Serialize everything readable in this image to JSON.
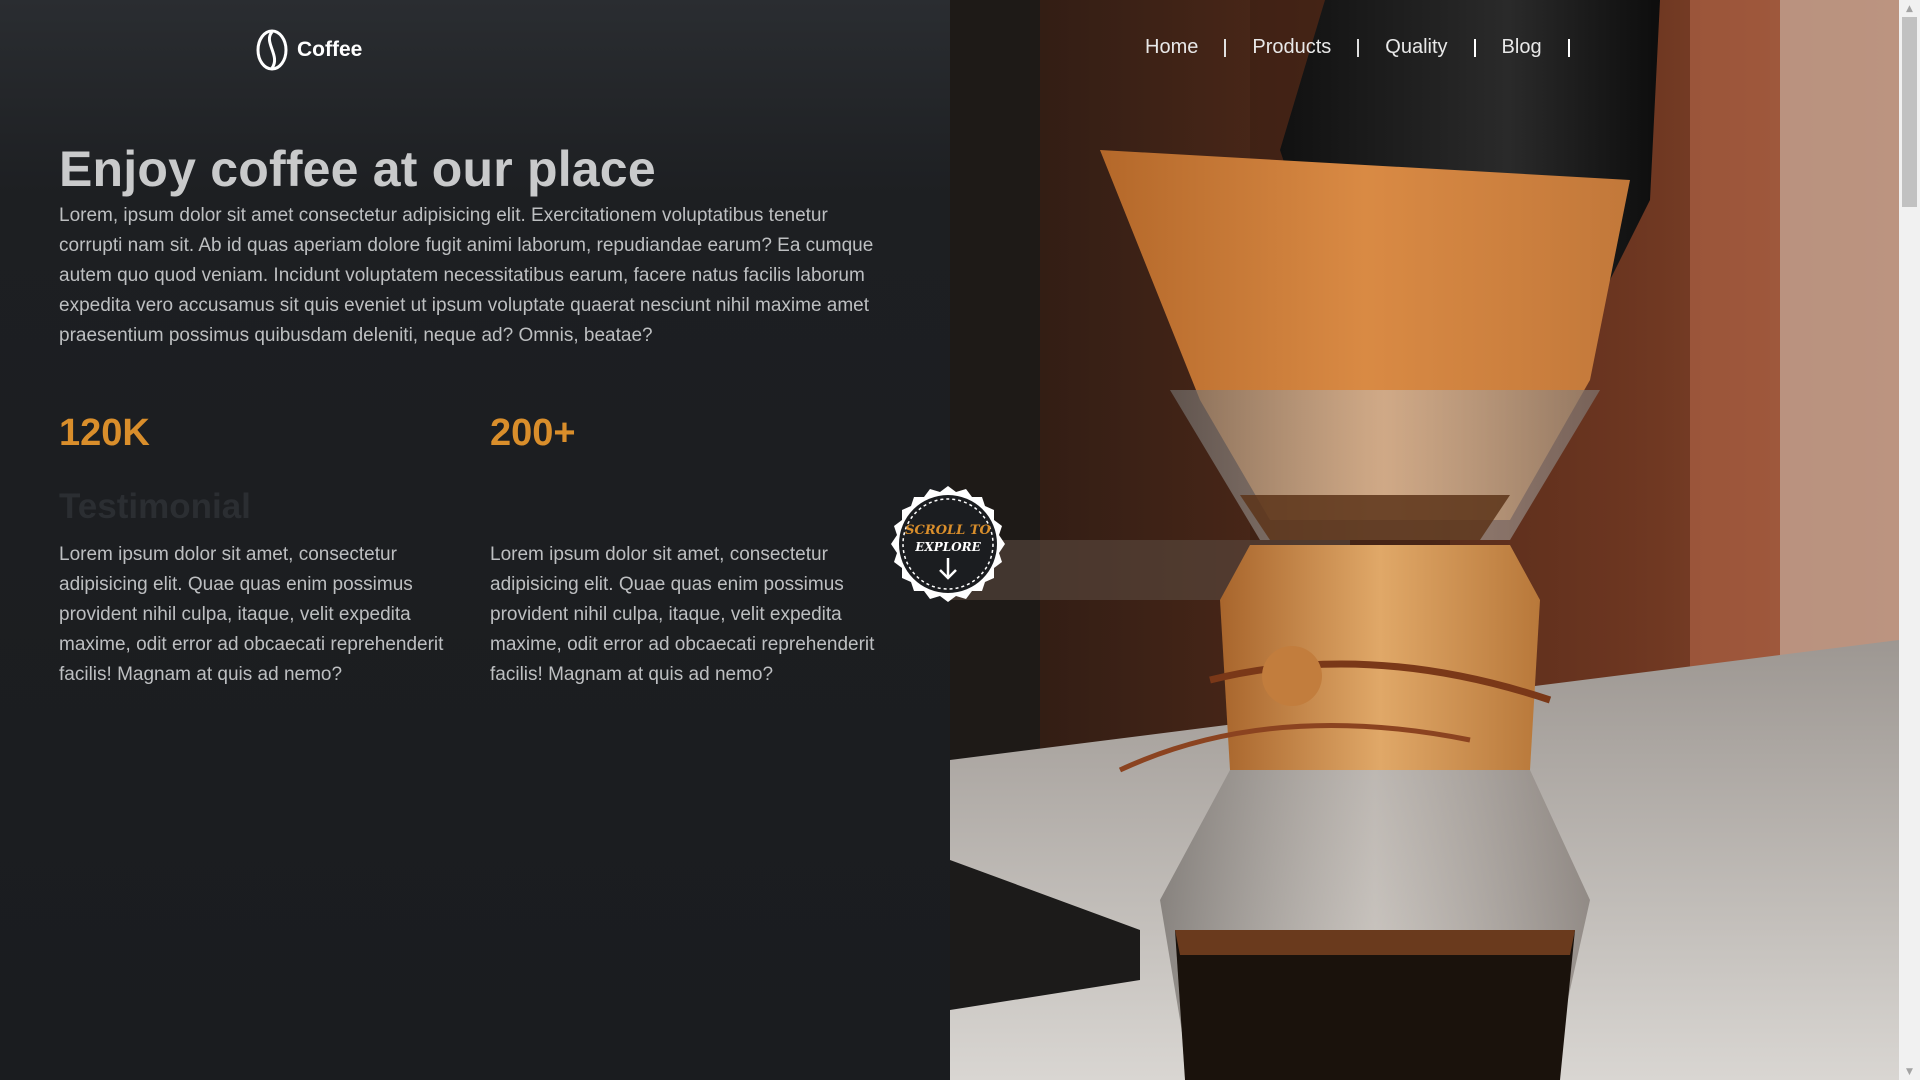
{
  "brand": {
    "name": "Coffee",
    "icon": "coffee-bean-icon"
  },
  "nav": {
    "items": [
      "Home",
      "Products",
      "Quality",
      "Blog"
    ]
  },
  "hero": {
    "title": "Enjoy coffee at our place",
    "text": "Lorem, ipsum dolor sit amet consectetur adipisicing elit. Exercitationem voluptatibus tenetur corrupti nam sit. Ab id quas aperiam dolore fugit animi laborum, repudiandae earum? Ea cumque autem quo quod veniam. Incidunt voluptatem necessitatibus earum, facere natus facilis laborum expedita vero accusamus sit quis eveniet ut ipsum voluptate quaerat nesciunt nihil maxime amet praesentium possimus quibusdam deleniti, neque ad? Omnis, beatae?"
  },
  "stats": [
    {
      "value": "120K",
      "text": "Lorem ipsum dolor sit amet, consectetur adipisicing elit. Quae quas enim possimus provident nihil culpa, itaque, velit expedita maxime, odit error ad obcaecati reprehenderit facilis! Magnam at quis ad nemo?"
    },
    {
      "value": "200+",
      "text": "Lorem ipsum dolor sit amet, consectetur adipisicing elit. Quae quas enim possimus provident nihil culpa, itaque, velit expedita maxime, odit error ad obcaecati reprehenderit facilis! Magnam at quis ad nemo?"
    }
  ],
  "faded_heading": "Testimonial",
  "badge": {
    "line1": "SCROLL TO",
    "line2": "EXPLORE",
    "icon": "arrow-down-icon"
  },
  "colors": {
    "accent": "#d98e2b",
    "background": "#1b1d20",
    "text": "#bdbfc1"
  }
}
